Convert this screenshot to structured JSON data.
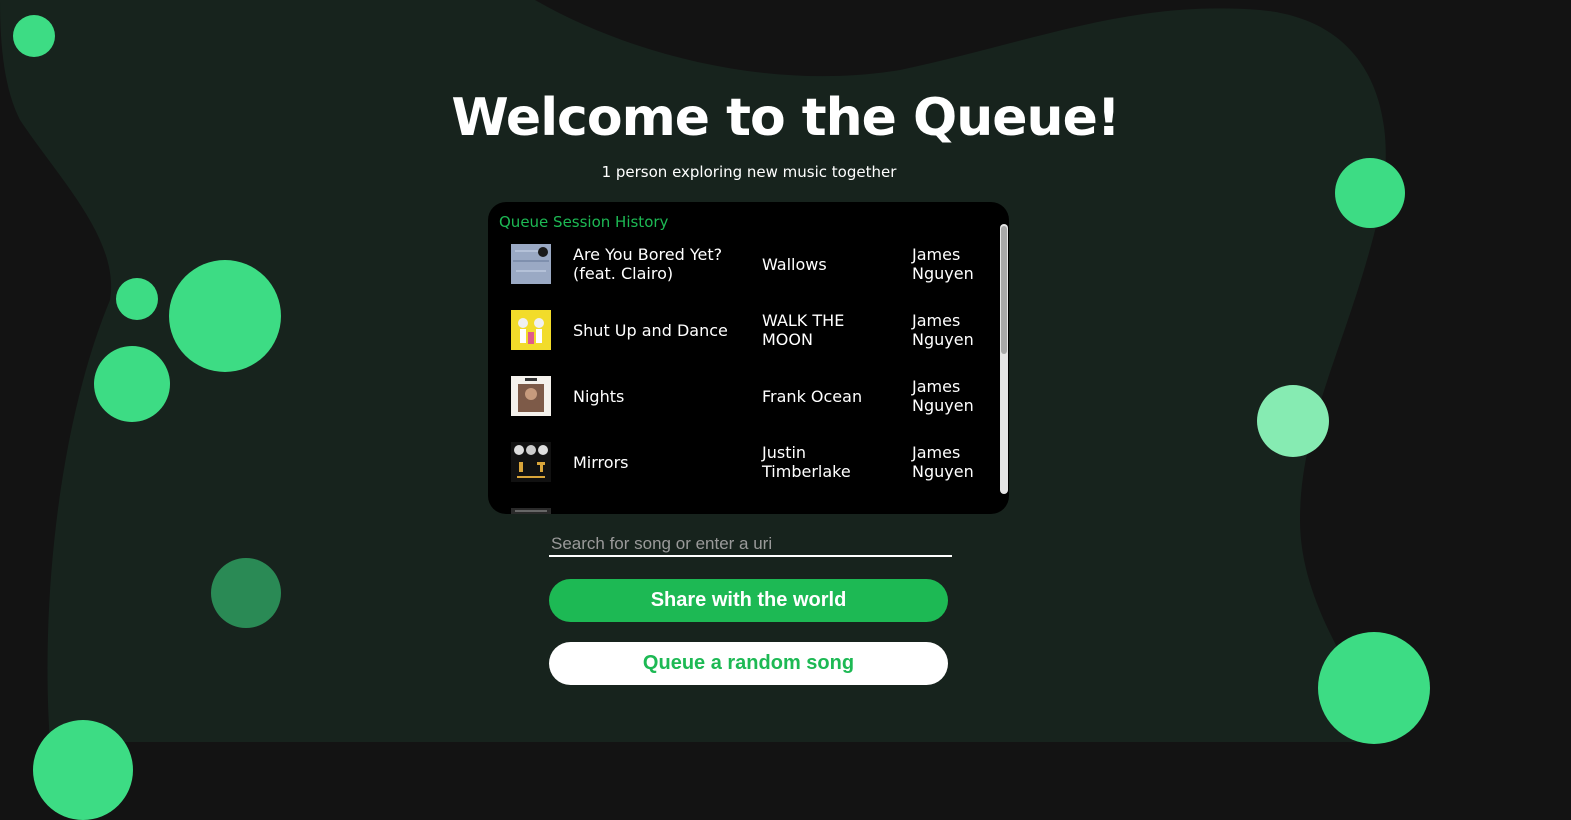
{
  "page": {
    "title": "Welcome to the Queue!",
    "subtitle": "1 person exploring new music together"
  },
  "queue": {
    "heading": "Queue Session History",
    "rows": [
      {
        "song": "Are You Bored Yet? (feat. Clairo)",
        "artist": "Wallows",
        "user": "James Nguyen",
        "art": "album-art-blue"
      },
      {
        "song": "Shut Up and Dance",
        "artist": "WALK THE MOON",
        "user": "James Nguyen",
        "art": "album-art-yellow"
      },
      {
        "song": "Nights",
        "artist": "Frank Ocean",
        "user": "James Nguyen",
        "art": "album-art-blonde"
      },
      {
        "song": "Mirrors",
        "artist": "Justin Timberlake",
        "user": "James Nguyen",
        "art": "album-art-2020"
      }
    ]
  },
  "search": {
    "placeholder": "Search for song or enter a uri",
    "value": ""
  },
  "buttons": {
    "share": "Share with the world",
    "random": "Queue a random song"
  },
  "colors": {
    "accent": "#1db954",
    "bubble": "#3ddc84",
    "background": "#131313",
    "blob": "#17231d"
  }
}
